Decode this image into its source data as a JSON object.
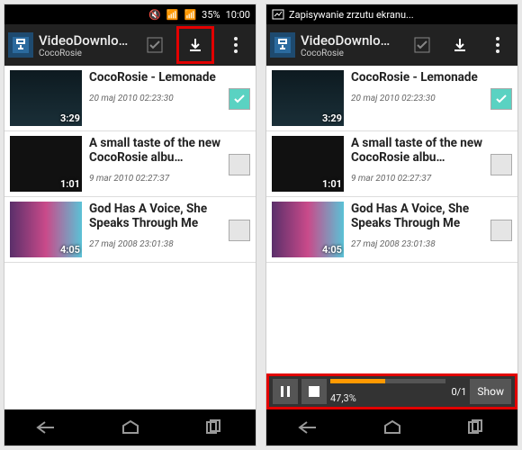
{
  "status": {
    "battery": "35%",
    "time": "10:00",
    "notification": "Zapisywanie zrzutu ekranu..."
  },
  "app": {
    "title": "VideoDownlo…",
    "subtitle": "CocoRosie"
  },
  "videos": [
    {
      "title": "CocoRosie - Lemonade",
      "date": "20 maj 2010 02:23:30",
      "dur": "3:29",
      "checked": true
    },
    {
      "title": "A small taste of the new CocoRosie albu…",
      "date": "9 mar 2010 02:27:37",
      "dur": "1:01",
      "checked": false
    },
    {
      "title": "God Has A Voice, She Speaks Through Me",
      "date": "27 maj 2008 23:01:38",
      "dur": "4:05",
      "checked": false
    }
  ],
  "download": {
    "percent": "47,3%",
    "counter": "0/1",
    "show": "Show"
  }
}
